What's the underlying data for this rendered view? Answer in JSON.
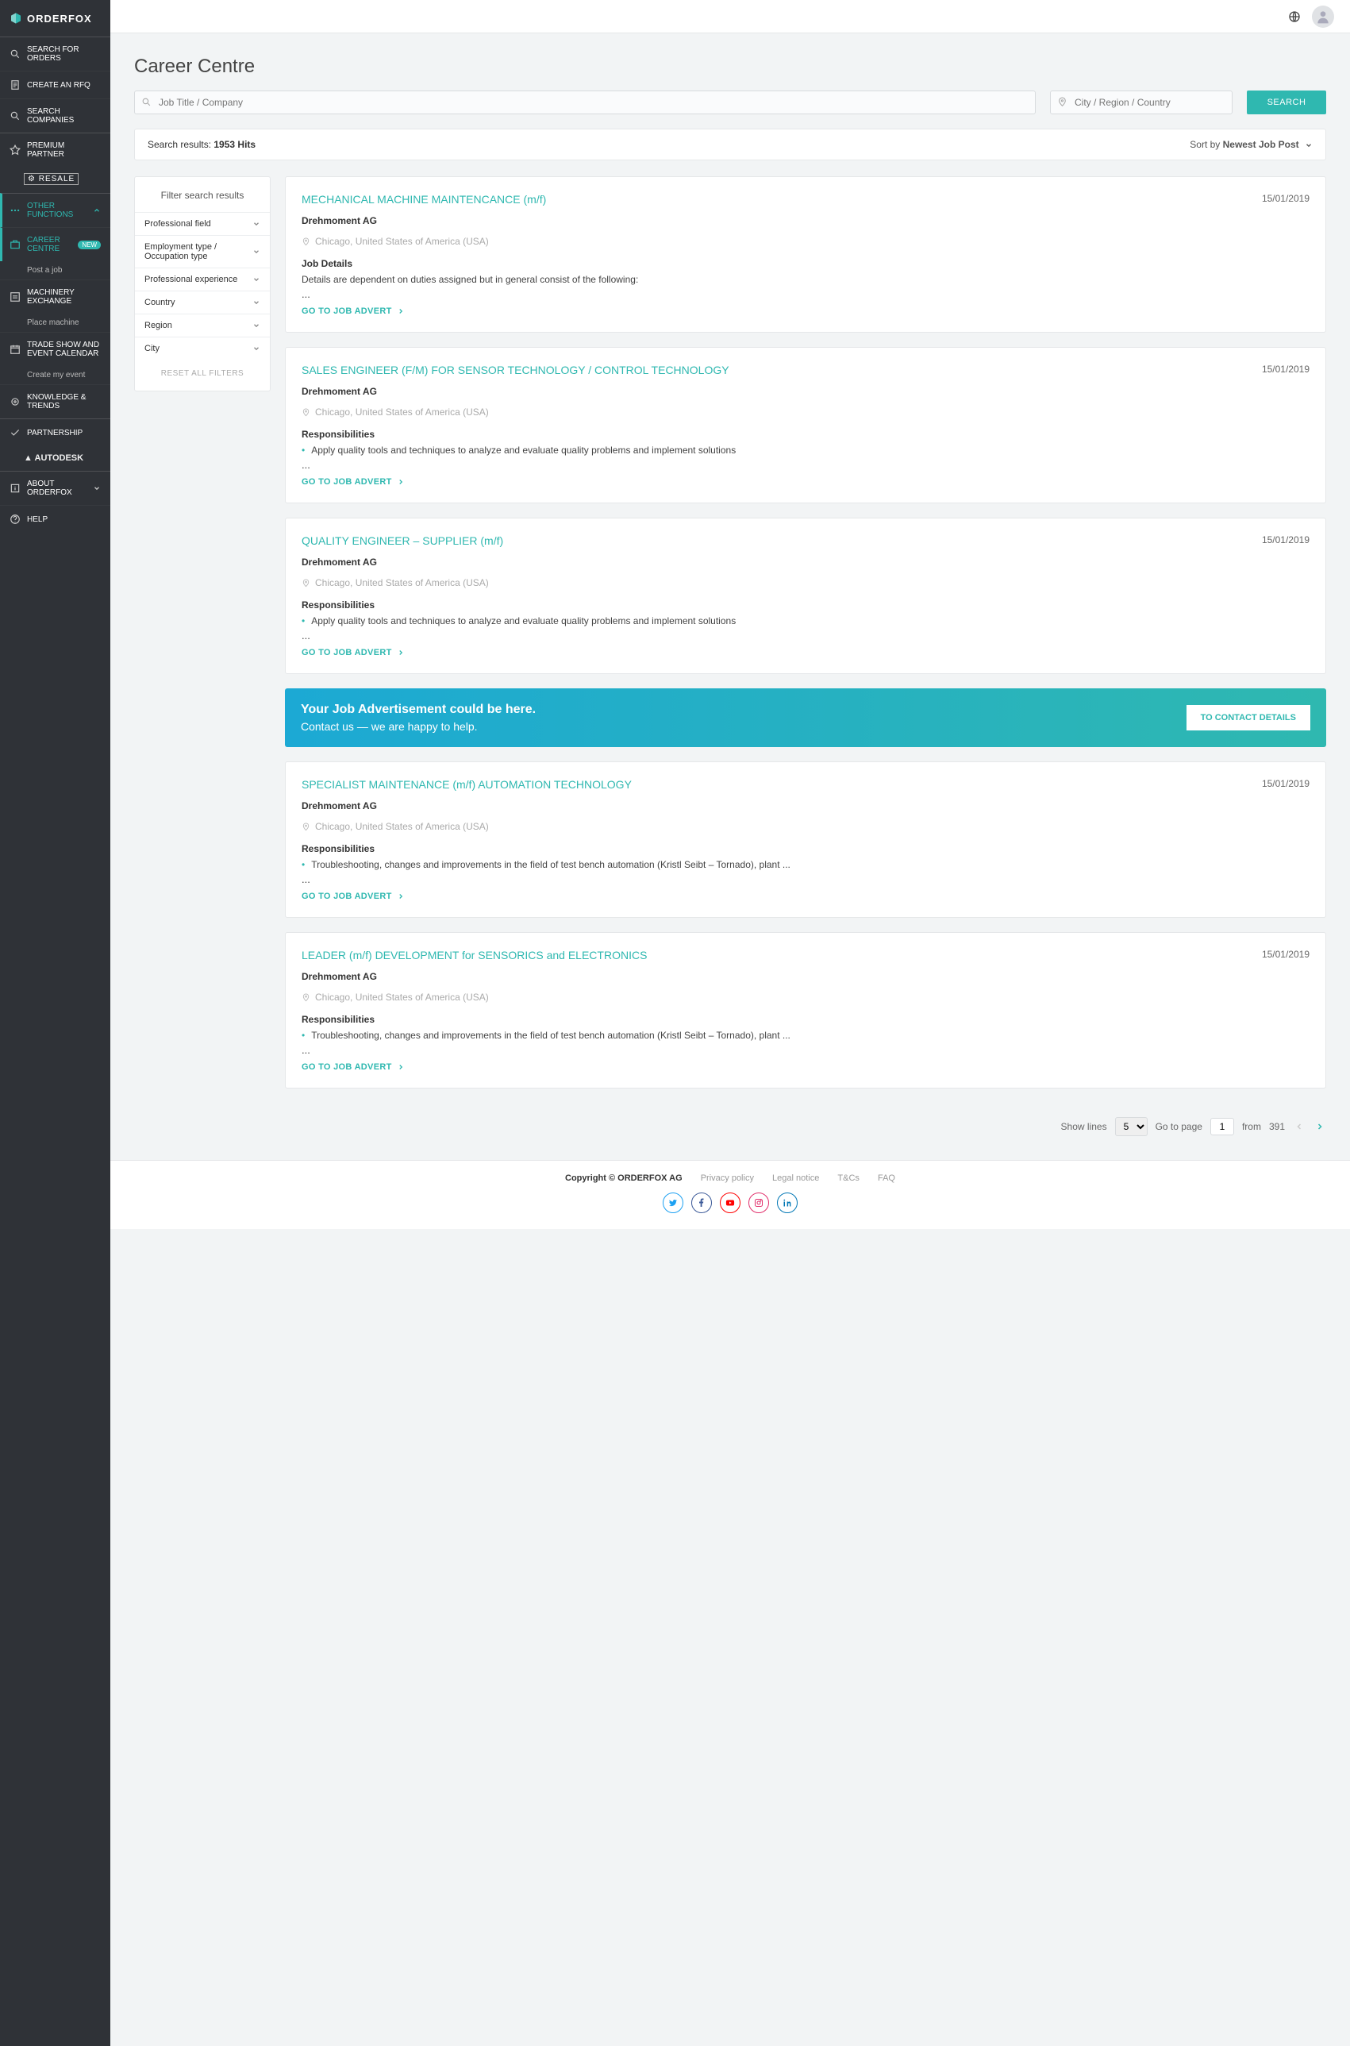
{
  "brand": "ORDERFOX",
  "sidebar": {
    "items": [
      {
        "label": "SEARCH FOR ORDERS"
      },
      {
        "label": "CREATE AN RFQ"
      },
      {
        "label": "SEARCH COMPANIES"
      },
      {
        "label": "PREMIUM PARTNER",
        "partner": "RESALE"
      },
      {
        "label": "OTHER FUNCTIONS"
      },
      {
        "label": "CAREER CENTRE",
        "badge": "NEW",
        "sub": "Post a job"
      },
      {
        "label": "MACHINERY EXCHANGE",
        "sub": "Place machine"
      },
      {
        "label": "TRADE SHOW AND EVENT CALENDAR",
        "sub": "Create my event"
      },
      {
        "label": "KNOWLEDGE & TRENDS"
      },
      {
        "label": "PARTNERSHIP",
        "partner": "AUTODESK"
      },
      {
        "label": "ABOUT ORDERFOX"
      },
      {
        "label": "HELP"
      }
    ]
  },
  "page_title": "Career Centre",
  "search": {
    "job_placeholder": "Job Title / Company",
    "loc_placeholder": "City / Region / Country",
    "button": "SEARCH"
  },
  "results_bar": {
    "prefix": "Search results: ",
    "hits": "1953 Hits",
    "sort_prefix": "Sort by ",
    "sort_value": "Newest Job Post"
  },
  "filters": {
    "title": "Filter search results",
    "rows": [
      "Professional field",
      "Employment type / Occupation type",
      "Professional experience",
      "Country",
      "Region",
      "City"
    ],
    "reset": "RESET ALL FILTERS"
  },
  "jobs": [
    {
      "title": "MECHANICAL MACHINE MAINTENCANCE (m/f)",
      "date": "15/01/2019",
      "company": "Drehmoment AG",
      "location": "Chicago, United States of America (USA)",
      "section": "Job Details",
      "desc": "Details are dependent on duties assigned but in general consist of the following:",
      "bullet": "",
      "link": "GO TO JOB ADVERT"
    },
    {
      "title": "SALES ENGINEER (F/M) FOR SENSOR TECHNOLOGY / CONTROL TECHNOLOGY",
      "date": "15/01/2019",
      "company": "Drehmoment AG",
      "location": "Chicago, United States of America (USA)",
      "section": "Responsibilities",
      "desc": "",
      "bullet": "Apply quality tools and techniques to analyze and evaluate quality problems and implement solutions",
      "link": "GO TO JOB ADVERT"
    },
    {
      "title": "QUALITY ENGINEER – SUPPLIER (m/f)",
      "date": "15/01/2019",
      "company": "Drehmoment AG",
      "location": "Chicago, United States of America (USA)",
      "section": "Responsibilities",
      "desc": "",
      "bullet": "Apply quality tools and techniques to analyze and evaluate quality problems and implement solutions",
      "link": "GO TO JOB ADVERT"
    },
    {
      "title": "SPECIALIST MAINTENANCE (m/f) AUTOMATION TECHNOLOGY",
      "date": "15/01/2019",
      "company": "Drehmoment AG",
      "location": "Chicago, United States of America (USA)",
      "section": "Responsibilities",
      "desc": "",
      "bullet": "Troubleshooting, changes and improvements in the field of test bench automation (Kristl Seibt – Tornado), plant ...",
      "link": "GO TO JOB ADVERT"
    },
    {
      "title": "LEADER (m/f) DEVELOPMENT for SENSORICS and ELECTRONICS",
      "date": "15/01/2019",
      "company": "Drehmoment AG",
      "location": "Chicago, United States of America (USA)",
      "section": "Responsibilities",
      "desc": "",
      "bullet": "Troubleshooting, changes and improvements in the field of test bench automation (Kristl Seibt – Tornado), plant ...",
      "link": "GO TO JOB ADVERT"
    }
  ],
  "promo": {
    "title": "Your Job Advertisement could be here.",
    "subtitle": "Contact us — we are happy to help.",
    "button": "TO CONTACT DETAILS"
  },
  "pagination": {
    "show_lines": "Show lines",
    "lines_value": "5",
    "go_to_page": "Go to page",
    "page_value": "1",
    "from": "from",
    "total": "391"
  },
  "footer": {
    "copyright": "Copyright © ORDERFOX AG",
    "links": [
      "Privacy policy",
      "Legal notice",
      "T&Cs",
      "FAQ"
    ]
  }
}
